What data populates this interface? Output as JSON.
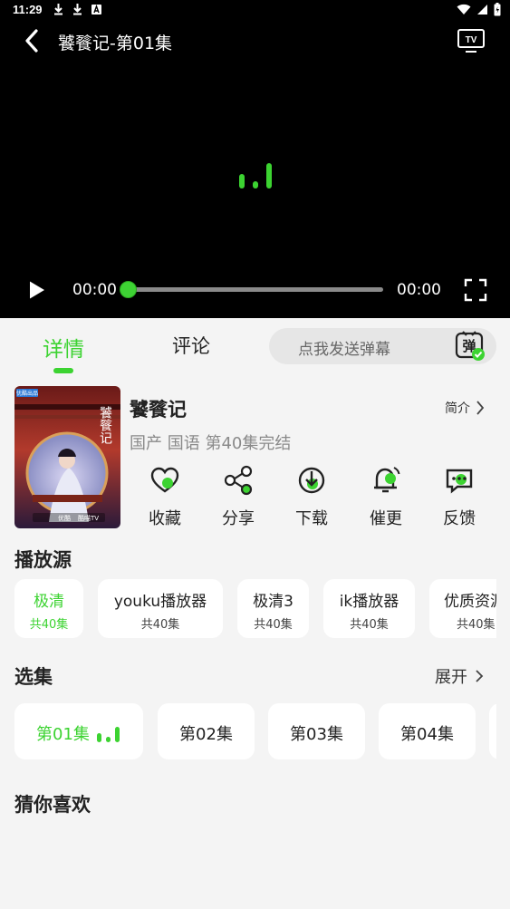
{
  "status": {
    "time": "11:29"
  },
  "player": {
    "title": "饕餮记-第01集",
    "time_current": "00:00",
    "time_total": "00:00",
    "progress": 0,
    "accent_color": "#3cd331"
  },
  "tabs": [
    {
      "label": "详情",
      "active": true
    },
    {
      "label": "评论",
      "active": false
    }
  ],
  "danmu": {
    "placeholder": "点我发送弹幕",
    "icon_text": "弹"
  },
  "show": {
    "title": "饕餮记",
    "intro_label": "简介",
    "meta": "国产 国语 第40集完结",
    "poster_text": [
      "优酷出品",
      "饕餮记",
      "优酷",
      "酷喵TV"
    ]
  },
  "actions": [
    {
      "label": "收藏",
      "icon": "heart-icon"
    },
    {
      "label": "分享",
      "icon": "share-icon"
    },
    {
      "label": "下载",
      "icon": "download-icon"
    },
    {
      "label": "催更",
      "icon": "bell-icon"
    },
    {
      "label": "反馈",
      "icon": "feedback-icon"
    }
  ],
  "sources_title": "播放源",
  "sources": [
    {
      "name": "极清",
      "count": "共40集",
      "active": true
    },
    {
      "name": "youku播放器",
      "count": "共40集",
      "active": false
    },
    {
      "name": "极清3",
      "count": "共40集",
      "active": false
    },
    {
      "name": "ik播放器",
      "count": "共40集",
      "active": false
    },
    {
      "name": "优质资源",
      "count": "共40集",
      "active": false
    }
  ],
  "episodes_title": "选集",
  "expand_label": "展开",
  "episodes": [
    {
      "label": "第01集",
      "active": true
    },
    {
      "label": "第02集",
      "active": false
    },
    {
      "label": "第03集",
      "active": false
    },
    {
      "label": "第04集",
      "active": false
    }
  ],
  "recommend_title": "猜你喜欢"
}
